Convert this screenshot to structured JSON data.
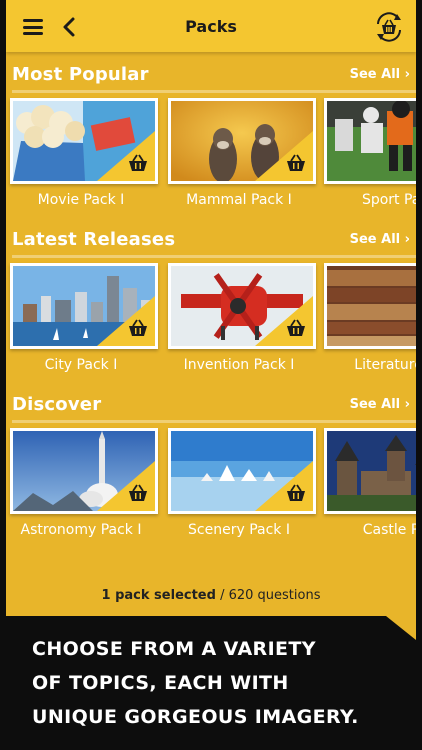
{
  "nav": {
    "title": "Packs"
  },
  "sections": [
    {
      "title": "Most Popular",
      "see_all": "See All",
      "packs": [
        {
          "label": "Movie Pack I"
        },
        {
          "label": "Mammal Pack I"
        },
        {
          "label": "Sport Pac"
        }
      ]
    },
    {
      "title": "Latest Releases",
      "see_all": "See All",
      "packs": [
        {
          "label": "City Pack I"
        },
        {
          "label": "Invention Pack I"
        },
        {
          "label": "Literature P"
        }
      ]
    },
    {
      "title": "Discover",
      "see_all": "See All",
      "packs": [
        {
          "label": "Astronomy Pack I"
        },
        {
          "label": "Scenery Pack I"
        },
        {
          "label": "Castle Pa"
        }
      ]
    }
  ],
  "footer": {
    "selected": "1 pack selected",
    "questions": " / 620 questions"
  },
  "promo": {
    "line1": "CHOOSE FROM A VARIETY",
    "line2": "OF TOPICS, EACH WITH",
    "line3": "UNIQUE GORGEOUS IMAGERY."
  },
  "colors": {
    "background": "#e8b52a",
    "nav": "#f4c630",
    "text": "#ffffff",
    "dark": "#0d0d0d"
  }
}
